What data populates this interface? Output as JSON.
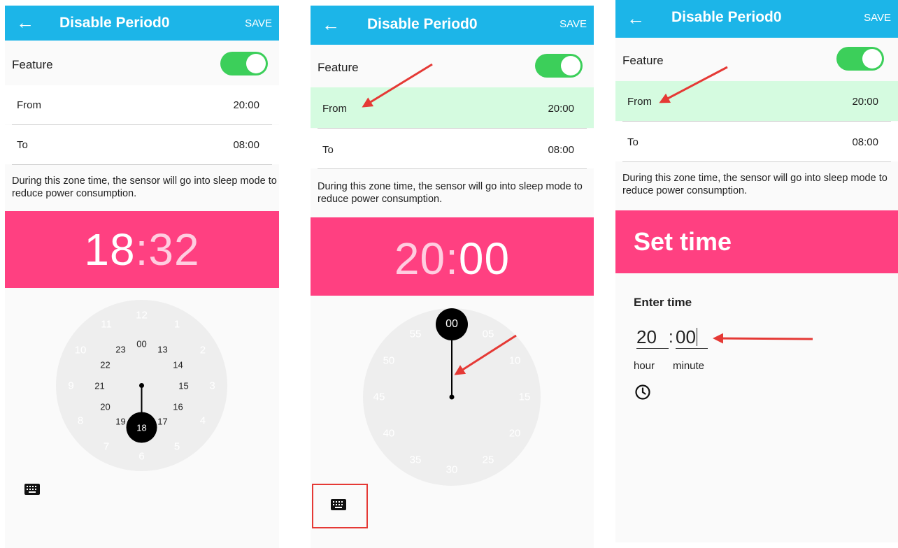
{
  "panels": [
    {
      "title": "Disable Period0",
      "save_label": "SAVE",
      "feature_label": "Feature",
      "from_label": "From",
      "from_value": "20:00",
      "to_label": "To",
      "to_value": "08:00",
      "description": "During this zone time, the sensor will go into sleep mode to reduce power consumption.",
      "header_hour": "18",
      "header_sep": ":",
      "header_minute": "32",
      "dial_outer": [
        "12",
        "1",
        "2",
        "3",
        "4",
        "5",
        "6",
        "7",
        "8",
        "9",
        "10",
        "11"
      ],
      "dial_inner": [
        "00",
        "13",
        "14",
        "15",
        "16",
        "17",
        "18",
        "19",
        "20",
        "21",
        "22",
        "23"
      ],
      "selected_value": "18",
      "icons": [
        "back-arrow-icon",
        "keyboard-icon"
      ]
    },
    {
      "title": "Disable Period0",
      "save_label": "SAVE",
      "feature_label": "Feature",
      "from_label": "From",
      "from_value": "20:00",
      "to_label": "To",
      "to_value": "08:00",
      "description": "During this zone time, the sensor will go into sleep mode to reduce power consumption.",
      "header_hour": "20",
      "header_sep": ":",
      "header_minute": "00",
      "dial_minutes": [
        "00",
        "05",
        "10",
        "15",
        "20",
        "25",
        "30",
        "35",
        "40",
        "45",
        "50",
        "55"
      ],
      "selected_value": "00",
      "icons": [
        "back-arrow-icon",
        "keyboard-icon"
      ]
    },
    {
      "title": "Disable Period0",
      "save_label": "SAVE",
      "feature_label": "Feature",
      "from_label": "From",
      "from_value": "20:00",
      "to_label": "To",
      "to_value": "08:00",
      "description": "During this zone time, the sensor will go into sleep mode to reduce power consumption.",
      "set_time_title": "Set time",
      "enter_time_label": "Enter time",
      "hour_value": "20",
      "sep": ":",
      "minute_value": "00",
      "hour_label": "hour",
      "minute_label": "minute",
      "icons": [
        "back-arrow-icon",
        "clock-icon"
      ]
    }
  ],
  "colors": {
    "toolbar": "#1cb5e8",
    "accent_pink": "#ff4081",
    "toggle_on": "#3ccf5a",
    "highlight_row": "#d5fbe0",
    "annotation_red": "#e53935"
  }
}
